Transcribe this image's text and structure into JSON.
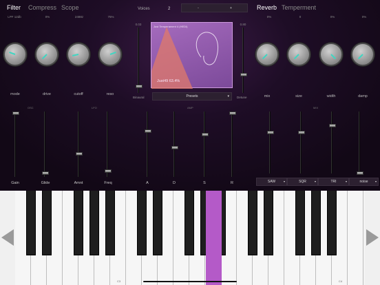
{
  "tabs_left": [
    {
      "label": "Filter",
      "active": true
    },
    {
      "label": "Compress",
      "active": false
    },
    {
      "label": "Scope",
      "active": false
    }
  ],
  "tabs_right": [
    {
      "label": "Reverb",
      "active": true
    },
    {
      "label": "Temperment",
      "active": false
    }
  ],
  "voices": {
    "label": "Voices",
    "value": "2",
    "minus": "-",
    "plus": "+"
  },
  "filter_readouts": [
    "LPF 12db",
    "0%",
    "2488z",
    "75%"
  ],
  "reverb_readouts": [
    "0%",
    "0",
    "0%",
    "0%"
  ],
  "filter_knobs": [
    "mode",
    "drive",
    "cutoff",
    "reso"
  ],
  "reverb_knobs": [
    "mix",
    "size",
    "width",
    "damp"
  ],
  "display": {
    "title": "Just Temperament 4 (HEDI)",
    "status": "Just49 63.4%",
    "left_top": "0.03",
    "right_top": "0.80",
    "left_label": "Binaural",
    "right_label": "Detune",
    "presets": "Presets"
  },
  "sections": {
    "osc": "OSC",
    "lfo": "LFO",
    "amp": "AMP",
    "mix": "MIX"
  },
  "slider_labels": [
    "Gain",
    "Glide",
    "Amnt",
    "Freq",
    "A",
    "D",
    "S",
    "R"
  ],
  "osc_buttons": [
    "SAW",
    "SQR",
    "TRI",
    "noise"
  ],
  "keyboard": {
    "octave_labels": [
      "C3",
      "C4"
    ],
    "active_key": "F#3"
  },
  "colors": {
    "accent": "#3fd6c2",
    "active_key": "#b45ac8",
    "background": "#1e0d26"
  }
}
